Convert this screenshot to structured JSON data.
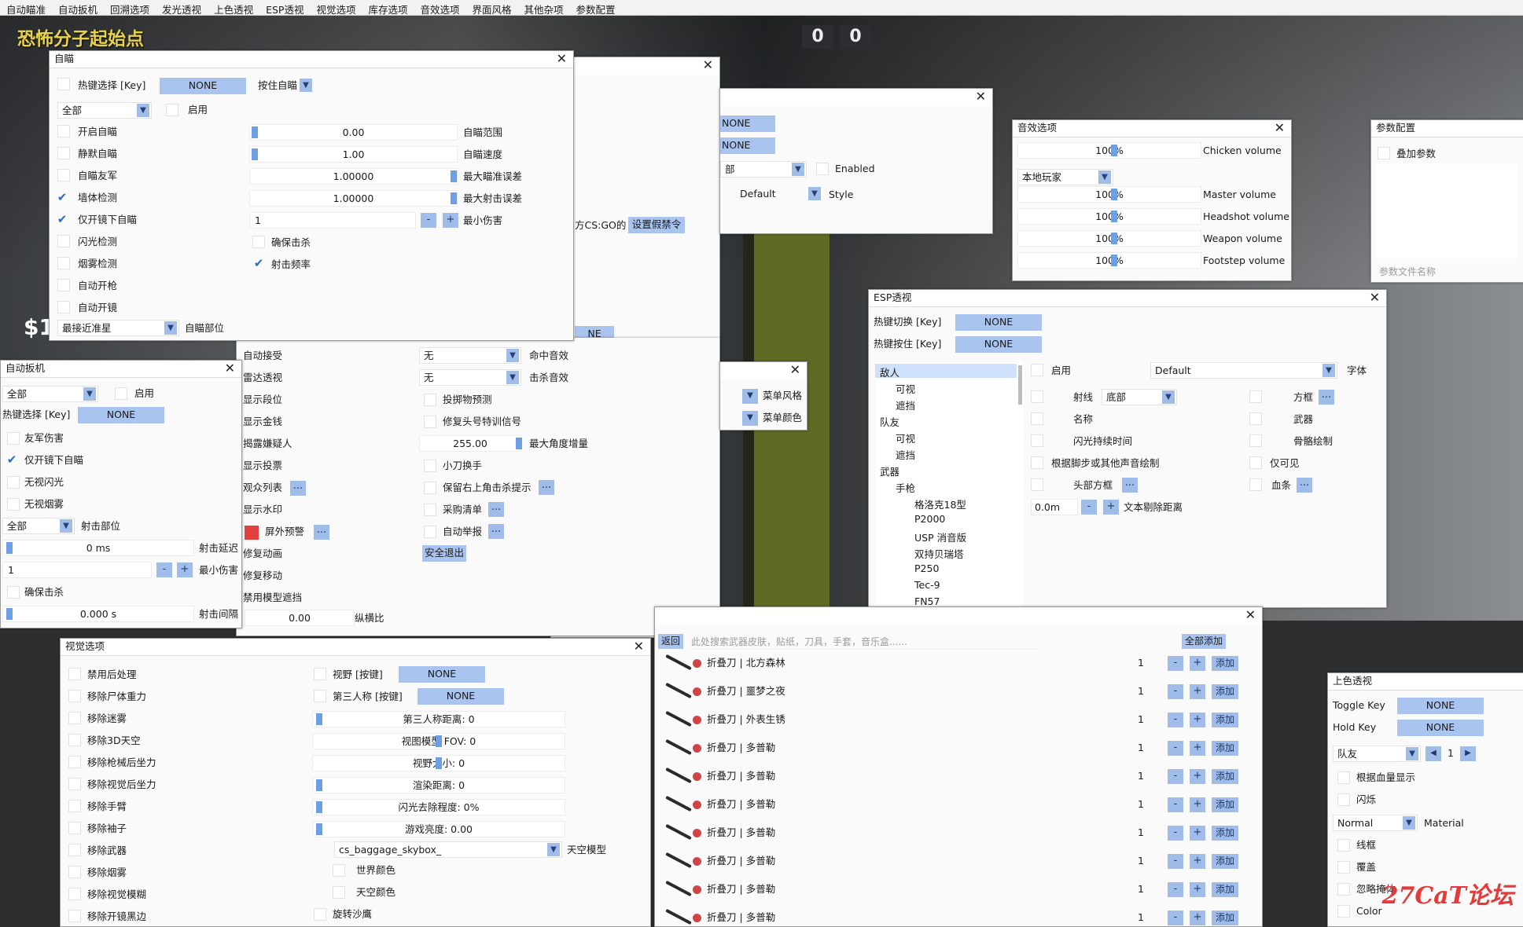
{
  "menu": [
    "自动瞄准",
    "自动扳机",
    "回溯选项",
    "发光透视",
    "上色透视",
    "ESP透视",
    "视觉选项",
    "库存选项",
    "音效选项",
    "界面风格",
    "其他杂项",
    "参数配置"
  ],
  "hud": {
    "title": "恐怖分子起始点",
    "score_left": "0",
    "score_right": "0",
    "money": "$1"
  },
  "aim": {
    "title": "自瞄",
    "hotkey_label": "热键选择 [Key]",
    "hotkey": "NONE",
    "mode": "按住自瞄",
    "scope": "全部",
    "enable": "启用",
    "rows": [
      "开启自瞄",
      "静默自瞄",
      "自瞄友军",
      "墙体检测",
      "仅开镜下自瞄",
      "闪光检测",
      "烟雾检测",
      "自动开枪",
      "自动开镜"
    ],
    "checked": [
      false,
      false,
      false,
      true,
      true,
      false,
      false,
      false,
      false
    ],
    "v_range": "0.00",
    "v_speed": "1.00",
    "v_err": "1.00000",
    "v_shot_err": "1.00000",
    "v_min_dmg": "1",
    "l_range": "自瞄范围",
    "l_speed": "自瞄速度",
    "l_err": "最大瞄准误差",
    "l_shot_err": "最大射击误差",
    "l_min_dmg": "最小伤害",
    "ensure_kill": "确保击杀",
    "fire_rate": "射击频率",
    "part_sel": "最接近准星",
    "part_label": "自瞄部位"
  },
  "trigger": {
    "title": "自动扳机",
    "scope": "全部",
    "enable": "启用",
    "hotkey_label": "热键选择 [Key]",
    "hotkey": "NONE",
    "friendly": "友军伤害",
    "scoped": "仅开镜下自瞄",
    "noflash": "无视闪光",
    "nosmoke": "无视烟雾",
    "part_scope": "全部",
    "part_label": "射击部位",
    "delay": "0 ms",
    "delay_label": "射击延迟",
    "min_dmg": "1",
    "min_dmg_label": "最小伤害",
    "ensure": "确保击杀",
    "interval": "0.000 s",
    "interval_label": "射击间隔"
  },
  "misc": {
    "col1": [
      "自动接受",
      "雷达透视",
      "显示段位",
      "显示金钱",
      "揭露嫌疑人",
      "显示投票",
      "观众列表",
      "显示水印",
      "屏外预警",
      "修复动画",
      "修复移动",
      "禁用模型遮挡"
    ],
    "hit_sound": "无",
    "hit_sound_label": "命中音效",
    "kill_sound": "无",
    "kill_sound_label": "击杀音效",
    "col2": [
      "投掷物预测",
      "修复头号特训信号"
    ],
    "max_angle": "255.00",
    "max_angle_label": "最大角度增量",
    "knife_swap": "小刀换手",
    "kill_notice": "保留右上角击杀提示",
    "buy_list": "采购清单",
    "auto_report": "自动举报",
    "safe_exit": "安全退出",
    "aspect": "0.00",
    "aspect_label": "纵横比",
    "fake_ban": "设置假禁令",
    "cs_text": "方CS:GO的",
    "none_btn": "NE"
  },
  "style_win": {
    "none1": "NONE",
    "none2": "NONE",
    "scope": "部",
    "enabled": "Enabled",
    "default": "Default",
    "style": "Style"
  },
  "menu_style": {
    "style": "菜单风格",
    "color": "菜单颜色"
  },
  "sound": {
    "title": "音效选项",
    "player": "本地玩家",
    "rows": [
      {
        "v": "100%",
        "l": "Chicken volume"
      },
      {
        "v": "100%",
        "l": "Master volume"
      },
      {
        "v": "100%",
        "l": "Headshot volume"
      },
      {
        "v": "100%",
        "l": "Weapon volume"
      },
      {
        "v": "100%",
        "l": "Footstep volume"
      }
    ]
  },
  "config": {
    "title": "参数配置",
    "add": "叠加参数",
    "placeholder": "参数文件名称"
  },
  "esp": {
    "title": "ESP透视",
    "toggle_label": "热键切换 [Key]",
    "toggle": "NONE",
    "hold_label": "热键按住 [Key]",
    "hold": "NONE",
    "tree": [
      {
        "t": "敌人",
        "d": 0
      },
      {
        "t": "可视",
        "d": 1
      },
      {
        "t": "遮挡",
        "d": 1
      },
      {
        "t": "队友",
        "d": 0
      },
      {
        "t": "可视",
        "d": 1
      },
      {
        "t": "遮挡",
        "d": 1
      },
      {
        "t": "武器",
        "d": 0
      },
      {
        "t": "手枪",
        "d": 1
      },
      {
        "t": "格洛克18型",
        "d": 2
      },
      {
        "t": "P2000",
        "d": 2
      },
      {
        "t": "USP 消音版",
        "d": 2
      },
      {
        "t": "双持贝瑞塔",
        "d": 2
      },
      {
        "t": "P250",
        "d": 2
      },
      {
        "t": "Tec-9",
        "d": 2
      },
      {
        "t": "FN57",
        "d": 2
      }
    ],
    "enable": "启用",
    "font": "Default",
    "font_label": "字体",
    "ray": "射线",
    "ray_pos": "底部",
    "box": "方框",
    "name": "名称",
    "weapon": "武器",
    "flash": "闪光持续时间",
    "skeleton": "骨骼绘制",
    "sound_draw": "根据脚步或其他声音绘制",
    "visible": "仅可见",
    "head_box": "头部方框",
    "health": "血条",
    "dist": "0.0m",
    "dist_label": "文本剔除距离"
  },
  "visual": {
    "title": "视觉选项",
    "rows": [
      "禁用后处理",
      "移除尸体重力",
      "移除迷雾",
      "移除3D天空",
      "移除枪械后坐力",
      "移除视觉后坐力",
      "移除手臂",
      "移除袖子",
      "移除武器",
      "移除烟雾",
      "移除视觉模糊",
      "移除开镜黑边"
    ],
    "fov_key": "视野 [按键]",
    "fov_key_v": "NONE",
    "tp_key": "第三人称 [按键]",
    "tp_key_v": "NONE",
    "sliders": [
      "第三人称距离: 0",
      "视图模型 FOV: 0",
      "视野大小: 0",
      "渲染距离: 0",
      "闪光去除程度: 0%",
      "游戏亮度: 0.00"
    ],
    "sky": "cs_baggage_skybox_",
    "sky_label": "天空模型",
    "world": "世界颜色",
    "skycolor": "天空颜色",
    "spin": "旋转沙鹰"
  },
  "skins": {
    "back": "返回",
    "search": "此处搜索武器皮肤，贴纸，刀具，手套，音乐盒......",
    "add_all": "全部添加",
    "items": [
      {
        "w": "折叠刀",
        "n": "北方森林",
        "q": "1"
      },
      {
        "w": "折叠刀",
        "n": "噩梦之夜",
        "q": "1"
      },
      {
        "w": "折叠刀",
        "n": "外表生锈",
        "q": "1"
      },
      {
        "w": "折叠刀",
        "n": "多普勒",
        "q": "1"
      },
      {
        "w": "折叠刀",
        "n": "多普勒",
        "q": "1"
      },
      {
        "w": "折叠刀",
        "n": "多普勒",
        "q": "1"
      },
      {
        "w": "折叠刀",
        "n": "多普勒",
        "q": "1"
      },
      {
        "w": "折叠刀",
        "n": "多普勒",
        "q": "1"
      },
      {
        "w": "折叠刀",
        "n": "多普勒",
        "q": "1"
      },
      {
        "w": "折叠刀",
        "n": "多普勒",
        "q": "1"
      }
    ],
    "add": "添加"
  },
  "chams": {
    "title": "上色透视",
    "toggle": "Toggle Key",
    "toggle_v": "NONE",
    "hold": "Hold Key",
    "hold_v": "NONE",
    "team": "队友",
    "page": "1",
    "hp": "根据血量显示",
    "blink": "闪烁",
    "mat": "Normal",
    "mat_label": "Material",
    "wire": "线框",
    "cover": "覆盖",
    "ignore": "忽略掩体",
    "color": "Color"
  },
  "watermark": "27CaT论坛"
}
